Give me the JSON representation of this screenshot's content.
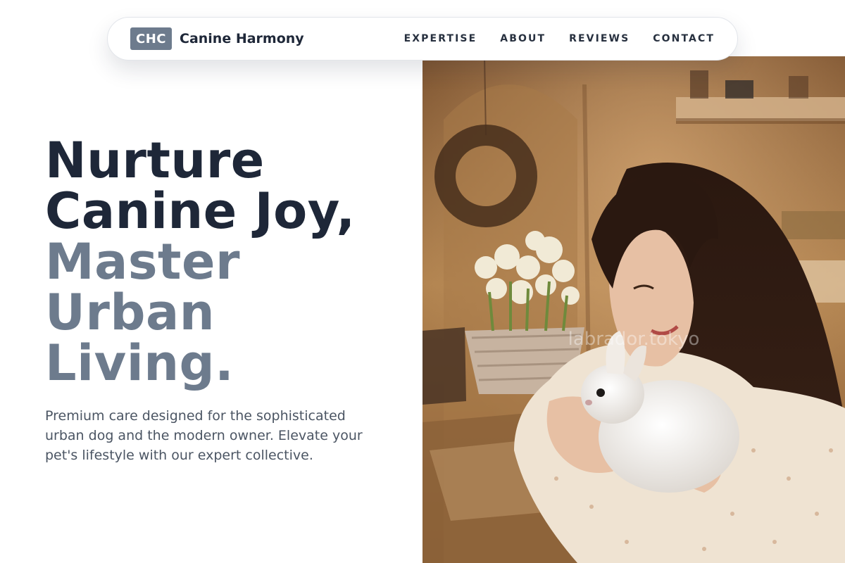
{
  "nav": {
    "logo_mark": "CHC",
    "brand_name": "Canine Harmony",
    "links": [
      {
        "label": "EXPERTISE"
      },
      {
        "label": "ABOUT"
      },
      {
        "label": "REVIEWS"
      },
      {
        "label": "CONTACT"
      }
    ]
  },
  "hero": {
    "headline": {
      "line1": "Nurture",
      "line2": "Canine Joy,",
      "line3": "Master",
      "line4": "Urban",
      "line5": "Living."
    },
    "description": "Premium care designed for the sophisticated urban dog and the modern owner. Elevate your pet's lifestyle with our expert collective."
  },
  "photo": {
    "watermark": "labrador.tokyo"
  },
  "colors": {
    "dark_text": "#1e2738",
    "muted_accent": "#6d7b8d",
    "body_text": "#4b5563"
  }
}
